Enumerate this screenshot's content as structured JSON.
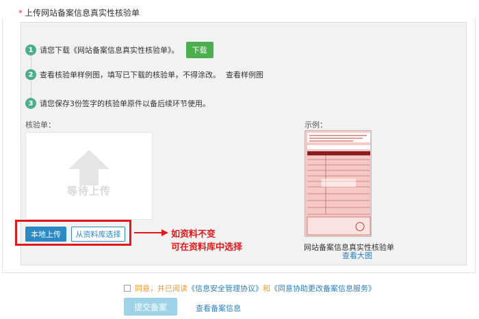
{
  "section": {
    "required_mark": "*",
    "title": "上传网站备案信息真实性核验单"
  },
  "steps": [
    {
      "num": "1",
      "text": "请您下载《网站备案信息真实性核验单》。",
      "button": "下载"
    },
    {
      "num": "2",
      "text": "查看核验单样例图，填写已下载的核验单，不得涂改。",
      "link": "查看样例图"
    },
    {
      "num": "3",
      "text": "请您保存3份签字的核验单原件以备后续环节使用。"
    }
  ],
  "upload": {
    "label": "核验单：",
    "placeholder": "等待上传",
    "local_button": "本地上传",
    "library_button": "从资料库选择"
  },
  "annotation": {
    "line1": "如资料不变",
    "line2": "可在资料库中选择"
  },
  "sample": {
    "label": "示例：",
    "caption": "网站备案信息真实性核验单",
    "view_link": "查看大图"
  },
  "agree": {
    "prefix": "同意，并已阅读",
    "link1": "《信息安全管理协议》",
    "and": "和",
    "link2": "《同意协助更改备案信息服务》"
  },
  "actions": {
    "submit": "提交备案",
    "view_info": "查看备案信息"
  },
  "colors": {
    "accent_green": "#4cae4c",
    "step_green": "#4cae8c",
    "primary_blue": "#2b89c5",
    "annotation_red": "#e3161a"
  }
}
